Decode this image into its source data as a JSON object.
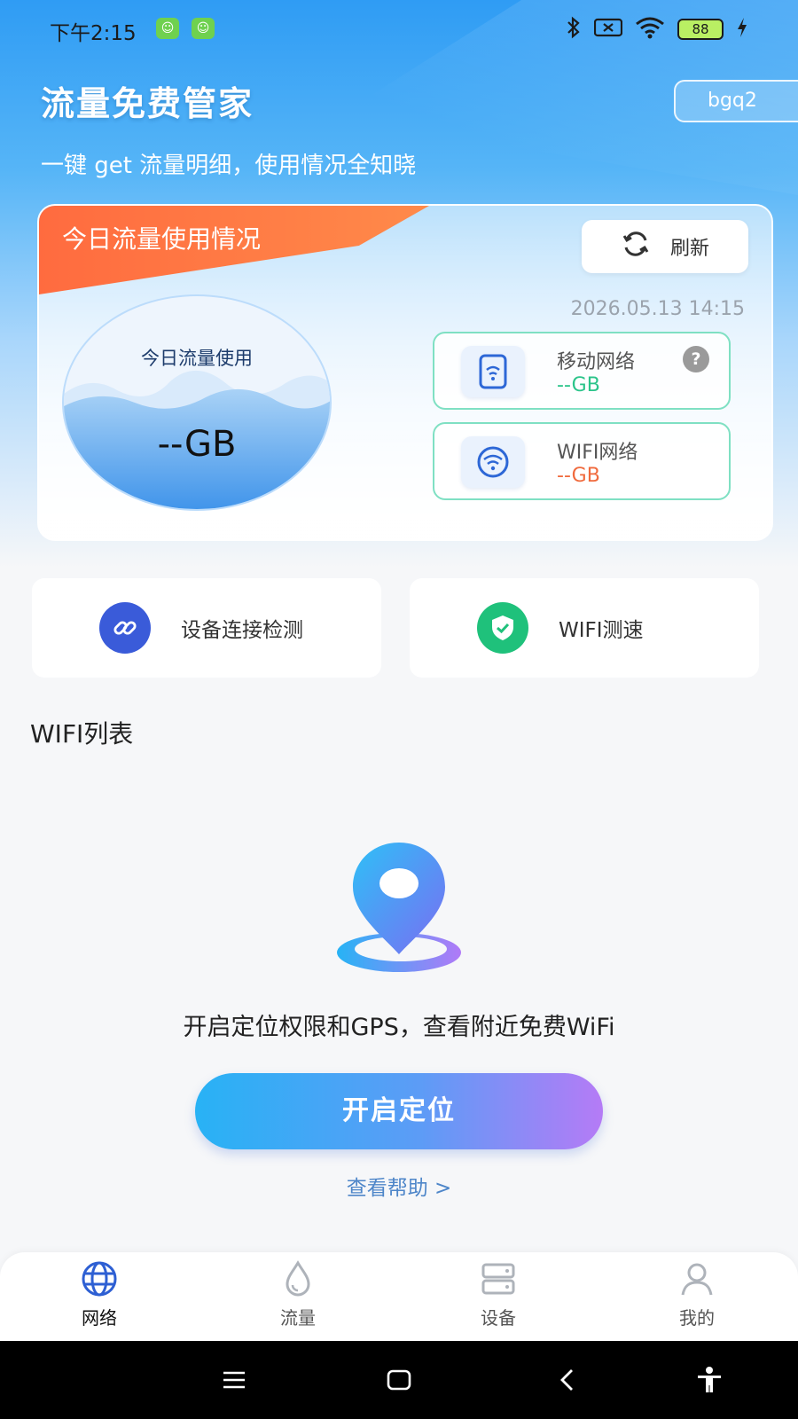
{
  "status_bar": {
    "time": "下午2:15",
    "battery": "88"
  },
  "header": {
    "title": "流量免费管家",
    "user_tag": "bgq2",
    "subtitle": "一键 get 流量明细，使用情况全知晓"
  },
  "usage_card": {
    "tab_label": "今日流量使用情况",
    "refresh_label": "刷新",
    "timestamp": "2026.05.13 14:15",
    "gauge_label": "今日流量使用",
    "gauge_value": "--GB",
    "mobile": {
      "name": "移动网络",
      "value": "--GB",
      "value_color": "#2bc48a"
    },
    "wifi": {
      "name": "WIFI网络",
      "value": "--GB",
      "value_color": "#f06a3d"
    }
  },
  "tools": [
    {
      "label": "设备连接检测",
      "icon": "link-icon",
      "color": "#3a5bd9"
    },
    {
      "label": "WIFI测速",
      "icon": "shield-check-icon",
      "color": "#1fc17b"
    }
  ],
  "wifi_list": {
    "title": "WIFI列表",
    "prompt": "开启定位权限和GPS，查看附近免费WiFi",
    "button_label": "开启定位",
    "help_link": "查看帮助 >"
  },
  "bottom_nav": [
    {
      "label": "网络",
      "icon": "globe-icon",
      "active": true
    },
    {
      "label": "流量",
      "icon": "drop-icon",
      "active": false
    },
    {
      "label": "设备",
      "icon": "server-icon",
      "active": false
    },
    {
      "label": "我的",
      "icon": "user-icon",
      "active": false
    }
  ],
  "system_nav": [
    "menu-icon",
    "home-icon",
    "back-icon",
    "accessibility-icon"
  ]
}
